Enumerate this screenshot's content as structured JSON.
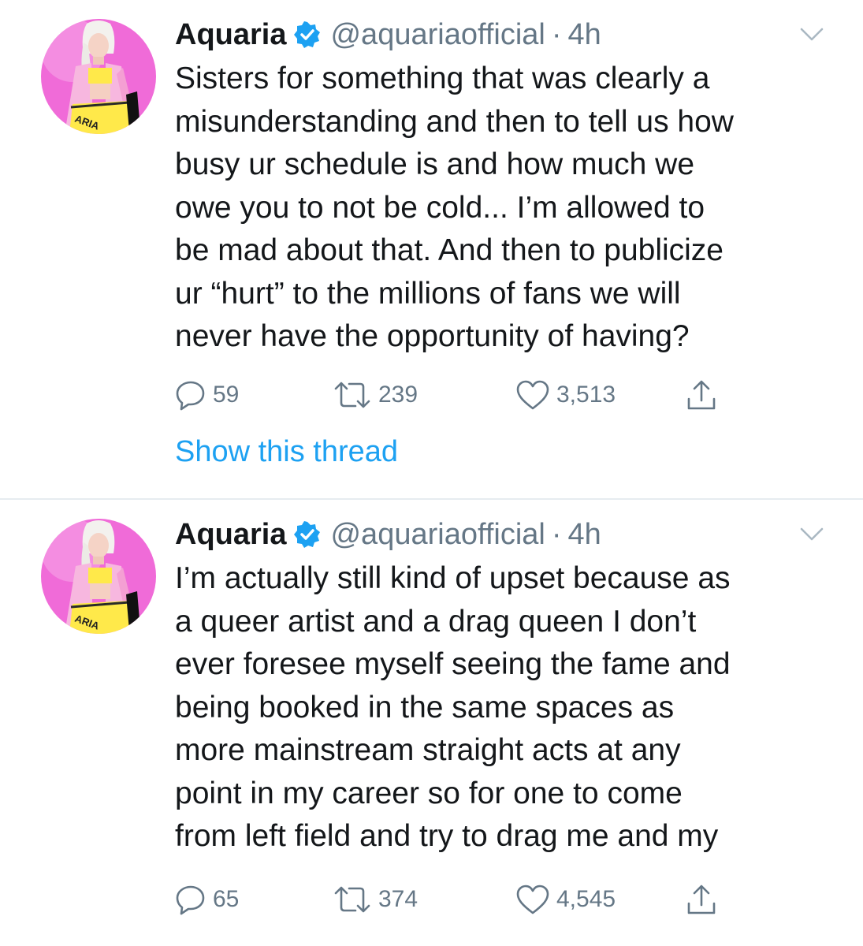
{
  "colors": {
    "text": "#14171a",
    "secondary": "#657786",
    "link": "#1da1f2",
    "verified_badge": "#1da1f2",
    "divider": "#e6ecf0",
    "avatar_background": "#f06bd8"
  },
  "tweets": [
    {
      "author": {
        "name": "Aquaria",
        "handle": "@aquariaofficial",
        "verified": true,
        "avatar_icon": "profile-photo"
      },
      "separator": "·",
      "time": "4h",
      "text": "Sisters for something that was clearly a\nmisunderstanding and then to tell us how\nbusy ur schedule is and how much we\nowe you to not be cold... I’m allowed to\nbe mad about that. And then to publicize\nur “hurt” to the millions of fans we will\nnever have the opportunity of having?",
      "replies": "59",
      "retweets": "239",
      "likes": "3,513",
      "thread_link": "Show this thread"
    },
    {
      "author": {
        "name": "Aquaria",
        "handle": "@aquariaofficial",
        "verified": true,
        "avatar_icon": "profile-photo"
      },
      "separator": "·",
      "time": "4h",
      "text": "I’m actually still kind of upset because as\na queer artist and a drag queen I don’t\never foresee myself seeing the fame and\nbeing booked in the same spaces as\nmore mainstream straight acts at any\npoint in my career so for one to come\nfrom left field and try to drag me and my",
      "replies": "65",
      "retweets": "374",
      "likes": "4,545"
    }
  ]
}
